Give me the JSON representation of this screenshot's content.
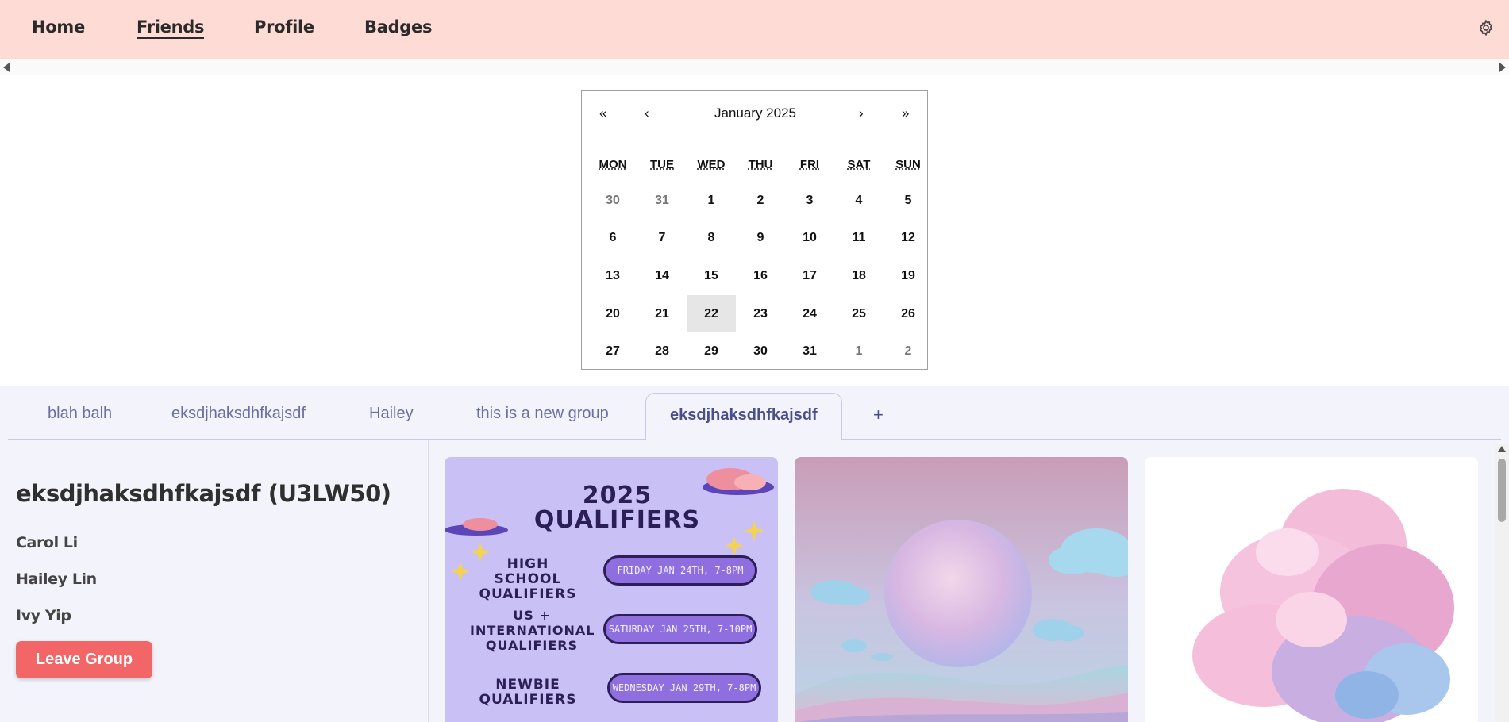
{
  "nav": {
    "items": [
      {
        "label": "Home"
      },
      {
        "label": "Friends"
      },
      {
        "label": "Profile"
      },
      {
        "label": "Badges"
      }
    ],
    "active": "Friends",
    "settings_icon": "gear-icon"
  },
  "calendar": {
    "title": "January 2025",
    "nav": {
      "prev_year": "«",
      "prev_month": "‹",
      "next_month": "›",
      "next_year": "»"
    },
    "weekdays": [
      "MON",
      "TUE",
      "WED",
      "THU",
      "FRI",
      "SAT",
      "SUN"
    ],
    "weeks": [
      [
        "30",
        "31",
        "1",
        "2",
        "3",
        "4",
        "5"
      ],
      [
        "6",
        "7",
        "8",
        "9",
        "10",
        "11",
        "12"
      ],
      [
        "13",
        "14",
        "15",
        "16",
        "17",
        "18",
        "19"
      ],
      [
        "20",
        "21",
        "22",
        "23",
        "24",
        "25",
        "26"
      ],
      [
        "27",
        "28",
        "29",
        "30",
        "31",
        "1",
        "2"
      ]
    ],
    "selected_day": "22"
  },
  "tabs": {
    "items": [
      {
        "label": "blah balh"
      },
      {
        "label": "eksdjhaksdhfkajsdf"
      },
      {
        "label": "Hailey"
      },
      {
        "label": "this is a new group"
      },
      {
        "label": "eksdjhaksdhfkajsdf"
      }
    ],
    "add_label": "+"
  },
  "group": {
    "title": "eksdjhaksdhfkajsdf (U3LW50)",
    "members": [
      "Carol Li",
      "Hailey Lin",
      "Ivy Yip"
    ],
    "leave_label": "Leave Group"
  },
  "gallery": {
    "poster": {
      "year": "2025",
      "heading": "QUALIFIERS",
      "rows": [
        {
          "name": "HIGH SCHOOL QUALIFIERS",
          "when": "FRIDAY JAN 24TH, 7-8PM"
        },
        {
          "name": "US + INTERNATIONAL QUALIFIERS",
          "when": "SATURDAY JAN 25TH, 7-10PM"
        },
        {
          "name": "NEWBIE QUALIFIERS",
          "when": "WEDNESDAY JAN 29TH, 7-8PM"
        }
      ]
    }
  },
  "colors": {
    "nav_bg": "#fedcd5",
    "lower_bg": "#f3f3fc",
    "leave_button": "#f26667",
    "poster_bg": "#c9c0f5",
    "pill": "#8f6fe0"
  }
}
